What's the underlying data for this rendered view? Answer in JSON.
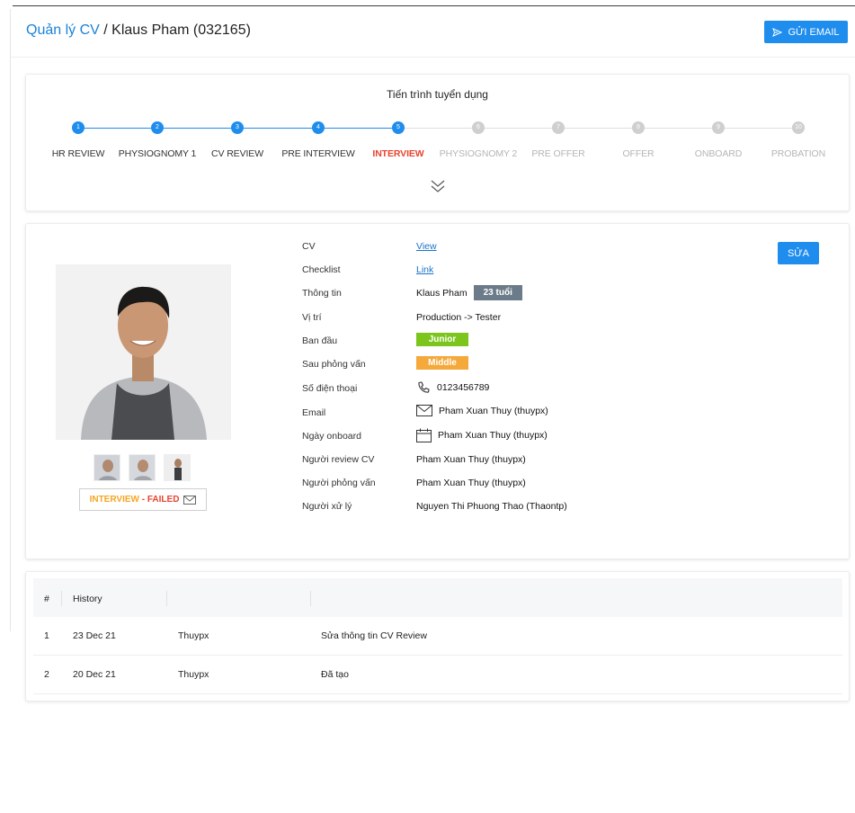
{
  "header": {
    "breadcrumb_link": "Quản lý CV",
    "breadcrumb_sep": " / ",
    "breadcrumb_current": "Klaus Pham (032165)",
    "email_button": "GỬI EMAIL"
  },
  "progress": {
    "title": "Tiến trình tuyển dụng",
    "steps": [
      {
        "num": "1",
        "label": "HR REVIEW",
        "state": "done"
      },
      {
        "num": "2",
        "label": "PHYSIOGNOMY 1",
        "state": "done"
      },
      {
        "num": "3",
        "label": "CV REVIEW",
        "state": "done"
      },
      {
        "num": "4",
        "label": "PRE INTERVIEW",
        "state": "done"
      },
      {
        "num": "5",
        "label": "INTERVIEW",
        "state": "active"
      },
      {
        "num": "6",
        "label": "PHYSIOGNOMY 2",
        "state": "todo"
      },
      {
        "num": "7",
        "label": "PRE OFFER",
        "state": "todo"
      },
      {
        "num": "8",
        "label": "OFFER",
        "state": "todo"
      },
      {
        "num": "9",
        "label": "ONBOARD",
        "state": "todo"
      },
      {
        "num": "10",
        "label": "PROBATION",
        "state": "todo"
      }
    ],
    "expand_icon": "double-chevron-down-icon"
  },
  "profile": {
    "status_stage": "INTERVIEW",
    "status_dash": " - ",
    "status_result": "FAILED",
    "edit_button": "SỬA",
    "labels": {
      "cv": "CV",
      "checklist": "Checklist",
      "info": "Thông tin",
      "position": "Vị trí",
      "initial": "Ban đầu",
      "after": "Sau phỏng vấn",
      "phone": "Số điện thoại",
      "email": "Email",
      "onboard": "Ngày onboard",
      "reviewer": "Người review CV",
      "interviewer": "Người phỏng vấn",
      "handler": "Người xử lý"
    },
    "values": {
      "cv": "View",
      "checklist": "Link",
      "name": "Klaus Pham",
      "age": "23 tuổi",
      "position": "Production -> Tester",
      "initial": "Junior",
      "after": "Middle",
      "phone": "0123456789",
      "email": "Pham Xuan Thuy (thuypx)",
      "onboard": "Pham Xuan Thuy (thuypx)",
      "reviewer": "Pham Xuan Thuy (thuypx)",
      "interviewer": "Pham Xuan Thuy (thuypx)",
      "handler": "Nguyen Thi Phuong Thao (Thaontp)"
    },
    "colors": {
      "junior": "#7bc51c",
      "middle": "#f5a93b",
      "age": "#6c7b89",
      "accent": "#1f8ded",
      "failed": "#e8432f"
    }
  },
  "history": {
    "headers": {
      "num": "#",
      "col": "History"
    },
    "rows": [
      {
        "num": "1",
        "date": "23 Dec 21",
        "user": "Thuypx",
        "action": "Sửa thông tin CV Review"
      },
      {
        "num": "2",
        "date": "20 Dec 21",
        "user": "Thuypx",
        "action": "Đã tạo"
      }
    ]
  }
}
